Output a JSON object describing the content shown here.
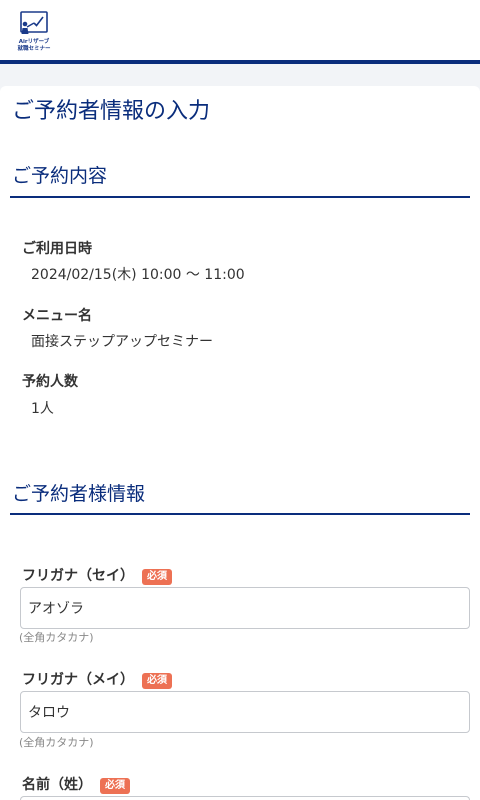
{
  "header": {
    "logo_line1": "Airリザーブ",
    "logo_line2": "就職セミナー"
  },
  "page": {
    "title": "ご予約者情報の入力"
  },
  "reservation": {
    "section_title": "ご予約内容",
    "items": [
      {
        "label": "ご利用日時",
        "value": "2024/02/15(木) 10:00 〜 11:00"
      },
      {
        "label": "メニュー名",
        "value": "面接ステップアップセミナー"
      },
      {
        "label": "予約人数",
        "value": "1人"
      }
    ]
  },
  "customer": {
    "section_title": "ご予約者様情報",
    "required_label": "必須",
    "fields": [
      {
        "label": "フリガナ（セイ）",
        "value": "アオゾラ",
        "hint": "(全角カタカナ)"
      },
      {
        "label": "フリガナ（メイ）",
        "value": "タロウ",
        "hint": "(全角カタカナ)"
      },
      {
        "label": "名前（姓）",
        "value": ""
      }
    ]
  },
  "colors": {
    "brand": "#0a2d7c",
    "required_badge": "#ed7154",
    "background": "#f2f4f7"
  }
}
